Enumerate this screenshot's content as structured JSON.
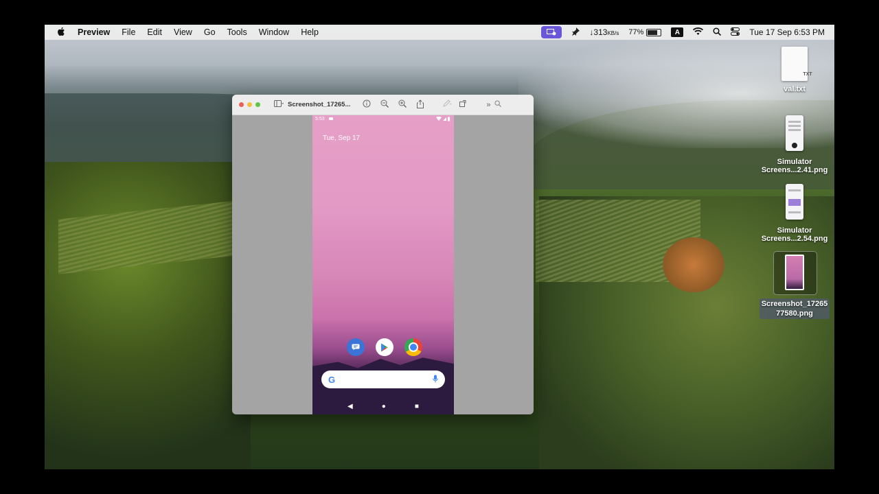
{
  "menubar": {
    "app_name": "Preview",
    "menus": [
      "File",
      "Edit",
      "View",
      "Go",
      "Tools",
      "Window",
      "Help"
    ],
    "network_speed": "↓313",
    "network_unit": "KB/s",
    "battery_percent": "77%",
    "battery_level": 0.77,
    "keyboard_indicator": "A",
    "datetime": "Tue 17 Sep  6:53 PM",
    "icons": [
      "apple-icon",
      "screen-share-icon",
      "pin-icon",
      "wifi-icon",
      "search-icon",
      "control-center-icon"
    ]
  },
  "desktop": {
    "items": [
      {
        "label": "val.txt",
        "ext": "TXT"
      },
      {
        "label_line1": "Simulator",
        "label_line2": "Screens...2.41.png"
      },
      {
        "label_line1": "Simulator",
        "label_line2": "Screens...2.54.png"
      },
      {
        "label_line1": "Screenshot_17265",
        "label_line2": "77580.png"
      }
    ]
  },
  "preview_window": {
    "title": "Screenshot_17265...",
    "toolbar_icons": [
      "sidebar-icon",
      "info-icon",
      "zoom-out-icon",
      "zoom-in-icon",
      "share-icon",
      "markup-icon",
      "rotate-icon",
      "more-icon",
      "search-icon"
    ]
  },
  "phone": {
    "time": "5:53",
    "date": "Tue, Sep 17",
    "dock_apps": [
      "messages-icon",
      "play-store-icon",
      "chrome-icon"
    ],
    "search_g": "G"
  },
  "colors": {
    "accent_purple": "#6a56d8",
    "phone_pink": "#e39ac5",
    "phone_dark": "#2c1638"
  }
}
